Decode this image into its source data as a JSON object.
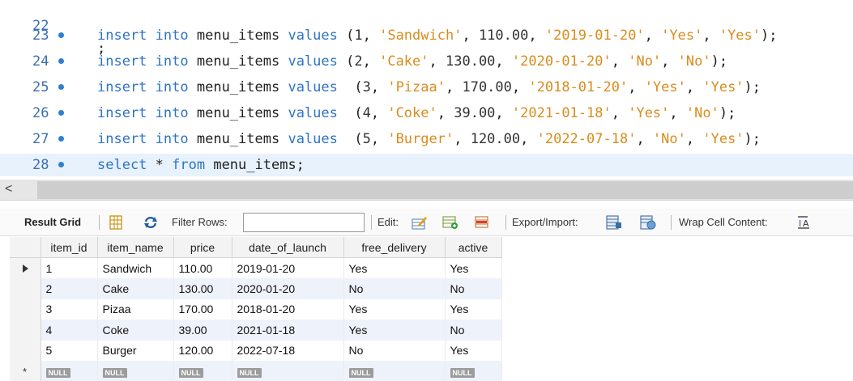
{
  "editor": {
    "top_fragment": {
      "line": "22",
      "text": ";"
    },
    "lines": [
      {
        "line": "23",
        "tokens": [
          [
            "kw",
            "insert"
          ],
          [
            "plain",
            " "
          ],
          [
            "kw",
            "into"
          ],
          [
            "plain",
            " menu_items "
          ],
          [
            "kw",
            "values"
          ],
          [
            "plain",
            " ("
          ],
          [
            "num",
            "1"
          ],
          [
            "plain",
            ", "
          ],
          [
            "str",
            "'Sandwich'"
          ],
          [
            "plain",
            ", "
          ],
          [
            "num",
            "110.00"
          ],
          [
            "plain",
            ", "
          ],
          [
            "str",
            "'2019-01-20'"
          ],
          [
            "plain",
            ", "
          ],
          [
            "str",
            "'Yes'"
          ],
          [
            "plain",
            ", "
          ],
          [
            "str",
            "'Yes'"
          ],
          [
            "plain",
            ");"
          ]
        ]
      },
      {
        "line": "24",
        "tokens": [
          [
            "kw",
            "insert"
          ],
          [
            "plain",
            " "
          ],
          [
            "kw",
            "into"
          ],
          [
            "plain",
            " menu_items "
          ],
          [
            "kw",
            "values"
          ],
          [
            "plain",
            " ("
          ],
          [
            "num",
            "2"
          ],
          [
            "plain",
            ", "
          ],
          [
            "str",
            "'Cake'"
          ],
          [
            "plain",
            ", "
          ],
          [
            "num",
            "130.00"
          ],
          [
            "plain",
            ", "
          ],
          [
            "str",
            "'2020-01-20'"
          ],
          [
            "plain",
            ", "
          ],
          [
            "str",
            "'No'"
          ],
          [
            "plain",
            ", "
          ],
          [
            "str",
            "'No'"
          ],
          [
            "plain",
            ");"
          ]
        ]
      },
      {
        "line": "25",
        "tokens": [
          [
            "kw",
            "insert"
          ],
          [
            "plain",
            " "
          ],
          [
            "kw",
            "into"
          ],
          [
            "plain",
            " menu_items "
          ],
          [
            "kw",
            "values"
          ],
          [
            "plain",
            "  ("
          ],
          [
            "num",
            "3"
          ],
          [
            "plain",
            ", "
          ],
          [
            "str",
            "'Pizaa'"
          ],
          [
            "plain",
            ", "
          ],
          [
            "num",
            "170.00"
          ],
          [
            "plain",
            ", "
          ],
          [
            "str",
            "'2018-01-20'"
          ],
          [
            "plain",
            ", "
          ],
          [
            "str",
            "'Yes'"
          ],
          [
            "plain",
            ", "
          ],
          [
            "str",
            "'Yes'"
          ],
          [
            "plain",
            ");"
          ]
        ]
      },
      {
        "line": "26",
        "tokens": [
          [
            "kw",
            "insert"
          ],
          [
            "plain",
            " "
          ],
          [
            "kw",
            "into"
          ],
          [
            "plain",
            " menu_items "
          ],
          [
            "kw",
            "values"
          ],
          [
            "plain",
            "  ("
          ],
          [
            "num",
            "4"
          ],
          [
            "plain",
            ", "
          ],
          [
            "str",
            "'Coke'"
          ],
          [
            "plain",
            ", "
          ],
          [
            "num",
            "39.00"
          ],
          [
            "plain",
            ", "
          ],
          [
            "str",
            "'2021-01-18'"
          ],
          [
            "plain",
            ", "
          ],
          [
            "str",
            "'Yes'"
          ],
          [
            "plain",
            ", "
          ],
          [
            "str",
            "'No'"
          ],
          [
            "plain",
            ");"
          ]
        ]
      },
      {
        "line": "27",
        "tokens": [
          [
            "kw",
            "insert"
          ],
          [
            "plain",
            " "
          ],
          [
            "kw",
            "into"
          ],
          [
            "plain",
            " menu_items "
          ],
          [
            "kw",
            "values"
          ],
          [
            "plain",
            "  ("
          ],
          [
            "num",
            "5"
          ],
          [
            "plain",
            ", "
          ],
          [
            "str",
            "'Burger'"
          ],
          [
            "plain",
            ", "
          ],
          [
            "num",
            "120.00"
          ],
          [
            "plain",
            ", "
          ],
          [
            "str",
            "'2022-07-18'"
          ],
          [
            "plain",
            ", "
          ],
          [
            "str",
            "'No'"
          ],
          [
            "plain",
            ", "
          ],
          [
            "str",
            "'Yes'"
          ],
          [
            "plain",
            ");"
          ]
        ]
      },
      {
        "line": "28",
        "tokens": [
          [
            "kw",
            "select"
          ],
          [
            "plain",
            " * "
          ],
          [
            "kw",
            "from"
          ],
          [
            "plain",
            " menu_items;"
          ]
        ]
      }
    ]
  },
  "scrollbar": {
    "left_arrow": "<"
  },
  "toolbar": {
    "result_grid": "Result Grid",
    "filter_rows": "Filter Rows:",
    "filter_value": "",
    "edit": "Edit:",
    "export_import": "Export/Import:",
    "wrap_cell": "Wrap Cell Content:"
  },
  "grid": {
    "columns": [
      "item_id",
      "item_name",
      "price",
      "date_of_launch",
      "free_delivery",
      "active"
    ],
    "rows": [
      [
        "1",
        "Sandwich",
        "110.00",
        "2019-01-20",
        "Yes",
        "Yes"
      ],
      [
        "2",
        "Cake",
        "130.00",
        "2020-01-20",
        "No",
        "No"
      ],
      [
        "3",
        "Pizaa",
        "170.00",
        "2018-01-20",
        "Yes",
        "Yes"
      ],
      [
        "4",
        "Coke",
        "39.00",
        "2021-01-18",
        "Yes",
        "No"
      ],
      [
        "5",
        "Burger",
        "120.00",
        "2022-07-18",
        "No",
        "Yes"
      ]
    ],
    "null_label": "NULL",
    "new_row_marker": "*"
  }
}
